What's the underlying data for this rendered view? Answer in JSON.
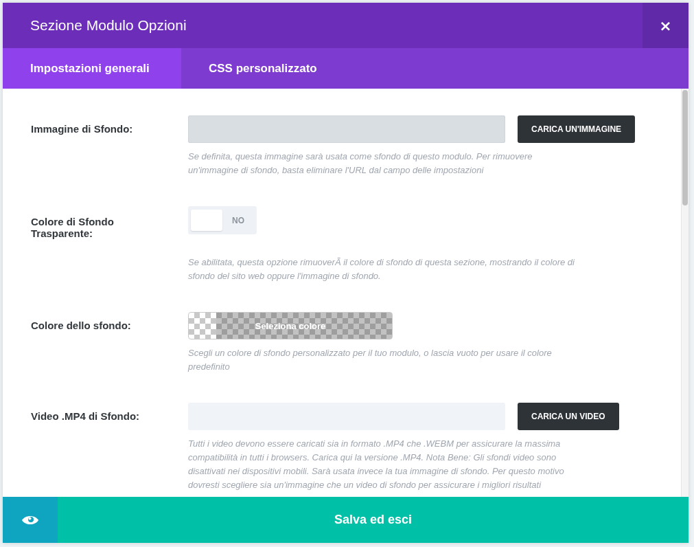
{
  "window": {
    "title": "Sezione Modulo Opzioni",
    "close": "×"
  },
  "tabs": [
    {
      "label": "Impostazioni generali",
      "selected": true
    },
    {
      "label": "CSS personalizzato",
      "selected": false
    }
  ],
  "settings": [
    {
      "kind": "upload",
      "label": "Immagine di Sfondo:",
      "button": "CARICA UN'IMMAGINE",
      "description": "Se definita, questa immagine sarà usata come sfondo di questo modulo. Per rimuovere un'immagine di sfondo, basta eliminare l'URL dal campo delle impostazioni",
      "focused": true
    },
    {
      "kind": "toggle",
      "label": "Colore di Sfondo Trasparente:",
      "on": false,
      "state_label": "NO",
      "description": "Se abilitata, questa opzione rimuoverÃ  il colore di sfondo di questa sezione, mostrando il colore di sfondo del sito web oppure l'immagine di sfondo."
    },
    {
      "kind": "color",
      "label": "Colore dello sfondo:",
      "button": "Seleziona colore",
      "description": "Scegli un colore di sfondo personalizzato per il tuo modulo, o lascia vuoto per usare il colore predefinito"
    },
    {
      "kind": "upload",
      "label": "Video .MP4 di Sfondo:",
      "button": "CARICA UN VIDEO",
      "description": "Tutti i video devono essere caricati sia in formato .MP4 che .WEBM per assicurare la massima compatibilità in tutti i browsers. Carica qui la versione .MP4. Nota Bene: Gli sfondi video sono disattivati nei dispositivi mobili. Sarà usata invece la tua immagine di sfondo. Per questo motivo dovresti scegliere sia un'immagine che un video di sfondo per assicurare i migliori risultati",
      "focused": false
    }
  ],
  "footer": {
    "save": "Salva ed esci"
  }
}
